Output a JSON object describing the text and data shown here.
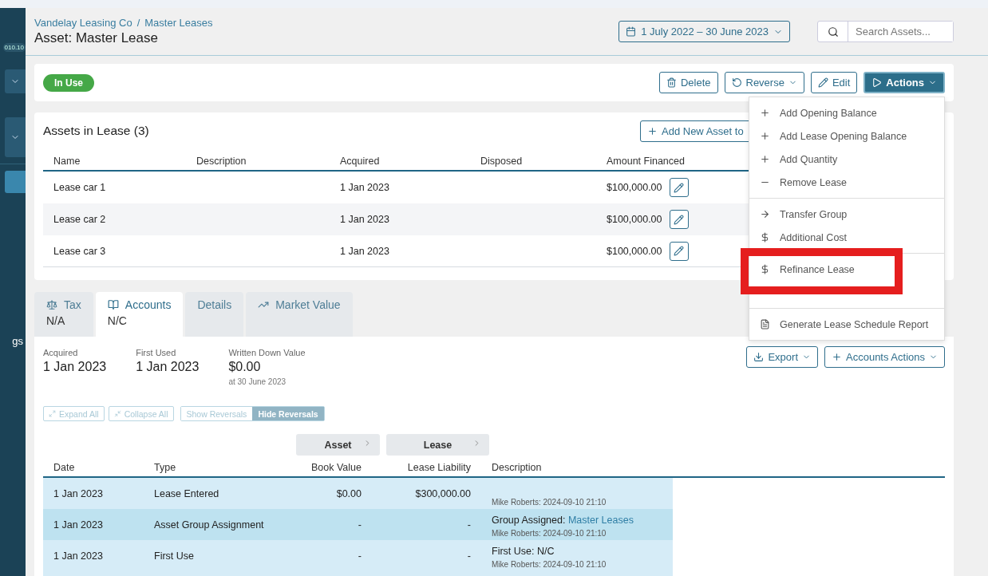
{
  "sidebar": {
    "version": "010.10",
    "label_fragment": "gs"
  },
  "header": {
    "breadcrumb": [
      "Vandelay Leasing Co",
      "Master Leases"
    ],
    "separator": "/",
    "title": "Asset: Master Lease",
    "date_range": "1 July 2022 – 30 June 2023",
    "search": {
      "placeholder": "Search Assets..."
    }
  },
  "status": {
    "label": "In Use"
  },
  "toolbar": {
    "buttons": [
      {
        "kind": "delete",
        "label": "Delete"
      },
      {
        "kind": "reverse",
        "label": "Reverse"
      },
      {
        "kind": "edit",
        "label": "Edit"
      }
    ],
    "actions": {
      "label": "Actions",
      "expanded": true
    }
  },
  "actions_menu": {
    "groups": [
      [
        {
          "kind": "plus",
          "label": "Add Opening Balance",
          "highlighted": false
        },
        {
          "kind": "plus",
          "label": "Add Lease Opening Balance",
          "highlighted": false
        },
        {
          "kind": "plus",
          "label": "Add Quantity",
          "highlighted": false
        },
        {
          "kind": "minus",
          "label": "Remove Lease",
          "highlighted": false
        }
      ],
      [
        {
          "kind": "arrow",
          "label": "Transfer Group",
          "highlighted": false
        },
        {
          "kind": "dollar",
          "label": "Additional Cost",
          "highlighted": false
        }
      ],
      [
        {
          "kind": "dollar",
          "label": "Refinance Lease",
          "highlighted": true
        }
      ],
      [
        {
          "kind": "document",
          "label": "Generate Lease Schedule Report",
          "highlighted": false
        }
      ]
    ]
  },
  "assets": {
    "title": "Assets in Lease (3)",
    "add_button": "Add New Asset to",
    "columns": [
      "Name",
      "Description",
      "Acquired",
      "Disposed",
      "Amount Financed"
    ],
    "rows": [
      {
        "name": "Lease car 1",
        "acquired": "1 Jan 2023",
        "amount": "$100,000.00"
      },
      {
        "name": "Lease car 2",
        "acquired": "1 Jan 2023",
        "amount": "$100,000.00"
      },
      {
        "name": "Lease car 3",
        "acquired": "1 Jan 2023",
        "amount": "$100,000.00"
      }
    ]
  },
  "tabs": [
    {
      "kind": "scale",
      "label": "Tax",
      "value": "N/A",
      "selected": false
    },
    {
      "kind": "book",
      "label": "Accounts",
      "value": "N/C",
      "selected": true
    },
    {
      "kind": "none",
      "label": "Details",
      "selected": false
    },
    {
      "kind": "trend",
      "label": "Market Value",
      "selected": false
    }
  ],
  "summary": [
    {
      "label": "Acquired",
      "value": "1 Jan 2023"
    },
    {
      "label": "First Used",
      "value": "1 Jan 2023"
    },
    {
      "label": "Written Down Value",
      "value": "$0.00",
      "note": "at 30 June 2023"
    }
  ],
  "accounts_buttons": [
    {
      "kind": "export",
      "label": "Export"
    },
    {
      "kind": "plus",
      "label": "Accounts Actions"
    }
  ],
  "controls": {
    "expand": "Expand All",
    "collapse": "Collapse All",
    "reversals": [
      {
        "label": "Show Reversals",
        "selected": false
      },
      {
        "label": "Hide Reversals",
        "selected": true
      }
    ]
  },
  "ledger": {
    "groups": [
      "Asset",
      "Lease"
    ],
    "columns": [
      "Date",
      "Type",
      "Book Value",
      "Lease Liability",
      "Description"
    ],
    "rows": [
      {
        "date": "1 Jan 2023",
        "type": "Lease Entered",
        "book_value": "$0.00",
        "liability": "$300,000.00",
        "meta": "Mike Roberts: 2024-09-10 21:10"
      },
      {
        "date": "1 Jan 2023",
        "type": "Asset Group Assignment",
        "book_value": "-",
        "liability": "-",
        "description": "Group Assigned:",
        "link": "Master Leases",
        "meta": "Mike Roberts: 2024-09-10 21:10"
      },
      {
        "date": "1 Jan 2023",
        "type": "First Use",
        "book_value": "-",
        "liability": "-",
        "description": "First Use: N/C",
        "meta": "Mike Roberts: 2024-09-10 21:10"
      }
    ]
  }
}
